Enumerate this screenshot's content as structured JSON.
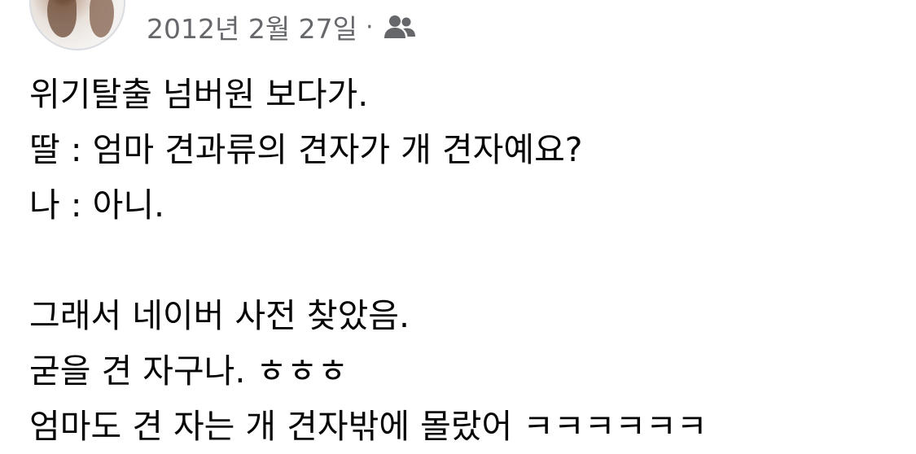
{
  "post": {
    "date": "2012년 2월 27일",
    "separator": "·",
    "audience_icon": "friends-icon",
    "lines": [
      "위기탈출 넘버원 보다가.",
      "딸 : 엄마 견과류의 견자가 개 견자예요?",
      "나 : 아니.",
      "",
      "그래서 네이버 사전 찾았음.",
      "굳을 견 자구나. ㅎㅎㅎ",
      "엄마도 견 자는 개 견자밖에 몰랐어 ㅋㅋㅋㅋㅋㅋ"
    ]
  },
  "colors": {
    "text": "#050505",
    "meta": "#65676b",
    "background": "#ffffff"
  }
}
